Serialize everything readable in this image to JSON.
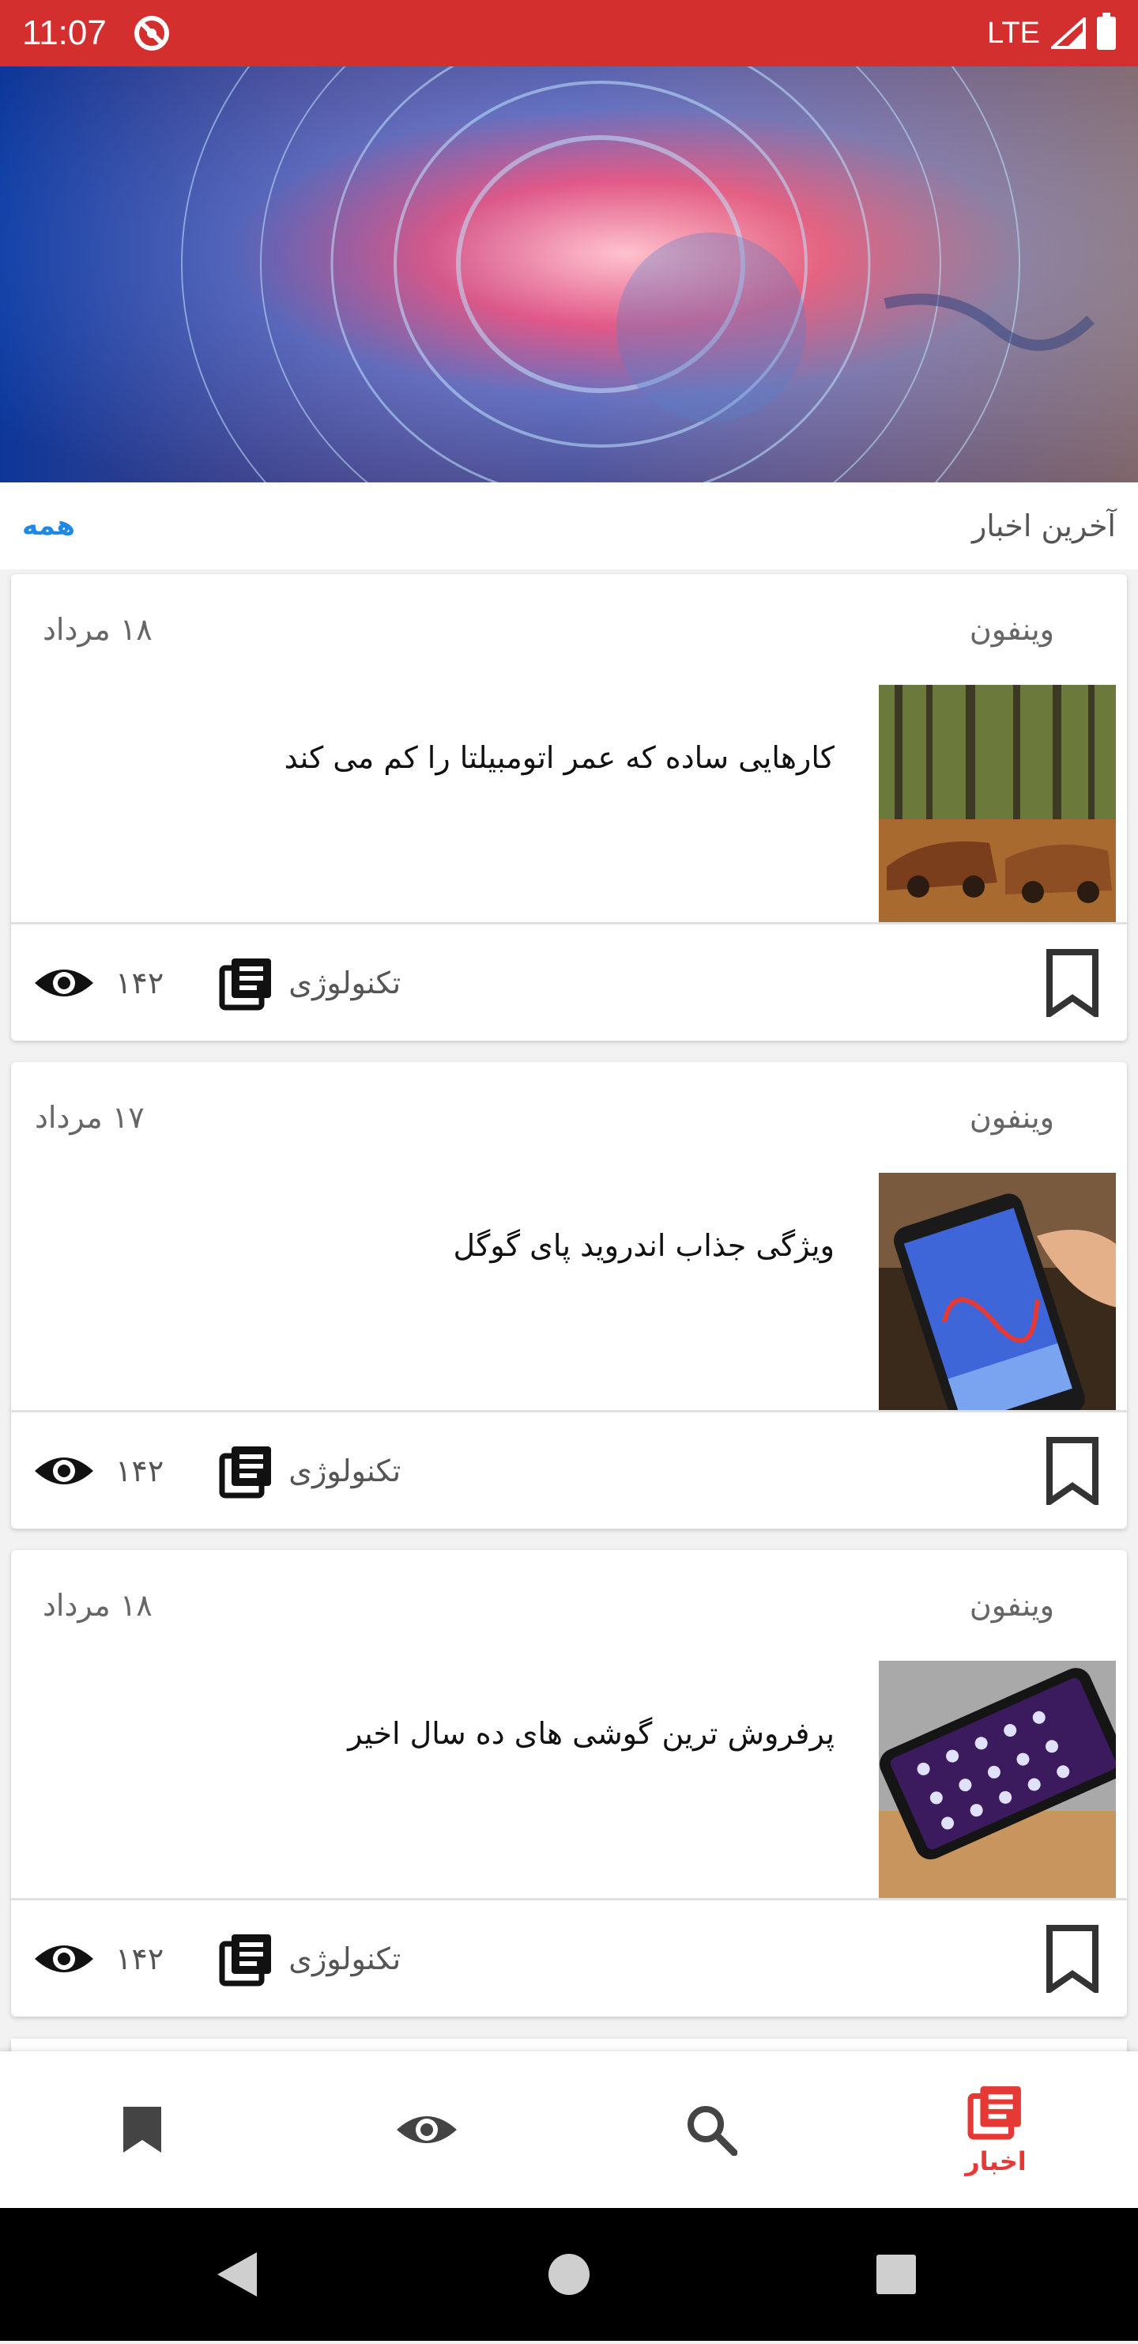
{
  "status_bar": {
    "time": "11:07",
    "network": "LTE"
  },
  "section": {
    "title": "آخرین اخبار",
    "all_link": "همه"
  },
  "news": [
    {
      "source": "وینفون",
      "date": "۱۸ مرداد",
      "title": "کارهایی ساده که عمر اتومبیلتا را کم می کند",
      "category": "تکنولوژی",
      "views": "۱۴۲",
      "thumb": "old-cars-in-forest"
    },
    {
      "source": "وینفون",
      "date": "۱۷ مرداد",
      "title": "ویژگی جذاب اندروید پای گوگل",
      "category": "تکنولوژی",
      "views": "۱۴۲",
      "thumb": "hand-on-phone"
    },
    {
      "source": "وینفون",
      "date": "۱۸ مرداد",
      "title": "پرفروش ترین گوشی های ده سال اخیر",
      "category": "تکنولوژی",
      "views": "۱۴۲",
      "thumb": "phone-on-table"
    }
  ],
  "bottom_nav": {
    "active_label": "اخبار",
    "items": [
      "bookmark-icon",
      "eye-icon",
      "search-icon",
      "news-icon"
    ]
  },
  "colors": {
    "status_bar": "#d32f2f",
    "accent": "#e53935",
    "link": "#1e88e5"
  }
}
